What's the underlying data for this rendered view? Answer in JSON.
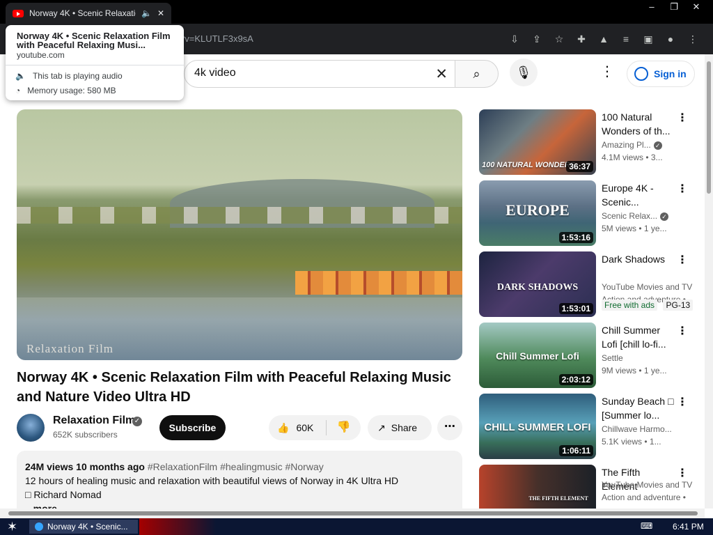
{
  "browser": {
    "tab_title": "Norway 4K • Scenic Relaxation",
    "url_fragment": "?v=KLUTLF3x9sA",
    "window_controls": [
      "–",
      "❐",
      "✕"
    ],
    "tab_popup": {
      "title": "Norway 4K • Scenic Relaxation Film with Peaceful Relaxing Musi...",
      "site": "youtube.com",
      "audio_note": "This tab is playing audio",
      "memory_note": "Memory usage: 580 MB"
    }
  },
  "header": {
    "search_value": "4k video",
    "signin_label": "Sign in"
  },
  "video": {
    "watermark": "Relaxation Film",
    "title": "Norway 4K • Scenic Relaxation Film with Peaceful Relaxing Music and Nature Video Ultra HD",
    "channel": "Relaxation Film",
    "subscribers": "652K subscribers",
    "subscribe_label": "Subscribe",
    "likes": "60K",
    "share_label": "Share",
    "description": {
      "stats": "24M views  10 months ago",
      "hashtags": "#RelaxationFilm #healingmusic #Norway",
      "line1": "12 hours of healing music and relaxation with beautiful views of Norway in 4K Ultra HD",
      "line2": "□ Richard Nomad",
      "more": "...more"
    }
  },
  "related": [
    {
      "thumb_text": "100 NATURAL WONDERS",
      "duration": "36:37",
      "title": "100 Natural Wonders of th...",
      "channel": "Amazing Pl...",
      "meta": "4.1M views  • 3..."
    },
    {
      "thumb_text": "EUROPE",
      "duration": "1:53:16",
      "title": "Europe 4K - Scenic...",
      "channel": "Scenic Relax...",
      "meta": "5M views  • 1 ye..."
    },
    {
      "thumb_text": "DARK SHADOWS",
      "duration": "1:53:01",
      "title": "Dark Shadows",
      "channel": "YouTube Movies and TV",
      "meta": "Action and adventure •",
      "badges": [
        "Free with ads",
        "PG-13"
      ]
    },
    {
      "thumb_text": "Chill Summer Lofi",
      "duration": "2:03:12",
      "title": "Chill Summer Lofi [chill lo-fi...",
      "channel": "Settle",
      "meta": "9M views  • 1 ye..."
    },
    {
      "thumb_text": "CHILL SUMMER LOFI",
      "duration": "1:06:11",
      "title": "Sunday Beach □ [Summer lo...",
      "channel": "Chillwave Harmo...",
      "meta": "5.1K views  • 1..."
    },
    {
      "thumb_text": "THE FIFTH ELEMENT",
      "duration": "",
      "title": "The Fifth Element",
      "channel": "YouTube Movies and TV",
      "meta": "Action and adventure •"
    }
  ],
  "taskbar": {
    "app_label": "Norway 4K • Scenic...",
    "clock": "6:41 PM"
  }
}
